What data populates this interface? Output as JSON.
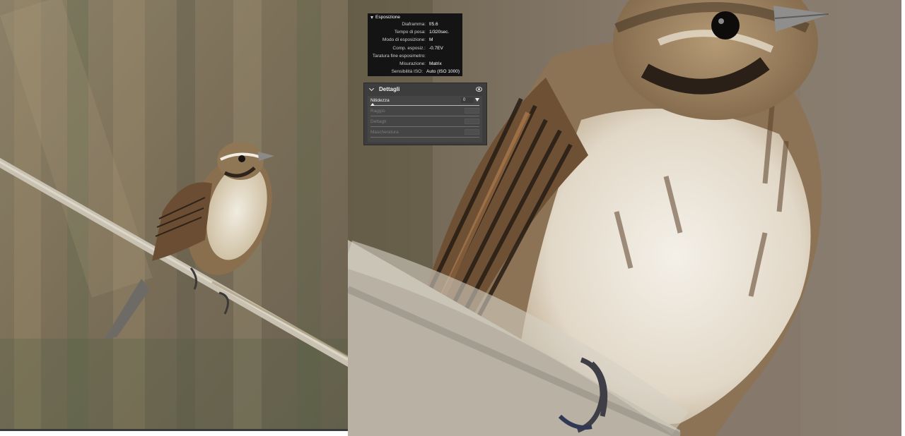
{
  "exif": {
    "section_title": "Esposizione",
    "rows": [
      {
        "label": "Diaframma:",
        "value": "f/5.6"
      },
      {
        "label": "Tempo di posa:",
        "value": "1/320sec."
      },
      {
        "label": "Modo di esposizione:",
        "value": "M"
      },
      {
        "label": "Comp. esposiz.:",
        "value": "-0.7EV"
      },
      {
        "label": "Taratura fine esposimetro:",
        "value": ""
      },
      {
        "label": "Misurazione:",
        "value": "Matrix"
      },
      {
        "label": "Sensibilità ISO:",
        "value": "Auto (ISO 1000)"
      }
    ]
  },
  "details": {
    "title": "Dettagli",
    "sliders": [
      {
        "label": "Nitidezza",
        "value": "0",
        "state": "active"
      },
      {
        "label": "Raggio",
        "value": "",
        "state": "disabled"
      },
      {
        "label": "Dettagli",
        "value": "",
        "state": "disabled"
      },
      {
        "label": "Mascheratura",
        "value": "",
        "state": "disabled"
      }
    ]
  },
  "icons": {
    "collapse": "triangle-down-icon",
    "chevron": "chevron-down-icon",
    "visibility": "eye-icon",
    "dropdown": "dropdown-triangle-icon",
    "slider": "slider-thumb-icon"
  }
}
